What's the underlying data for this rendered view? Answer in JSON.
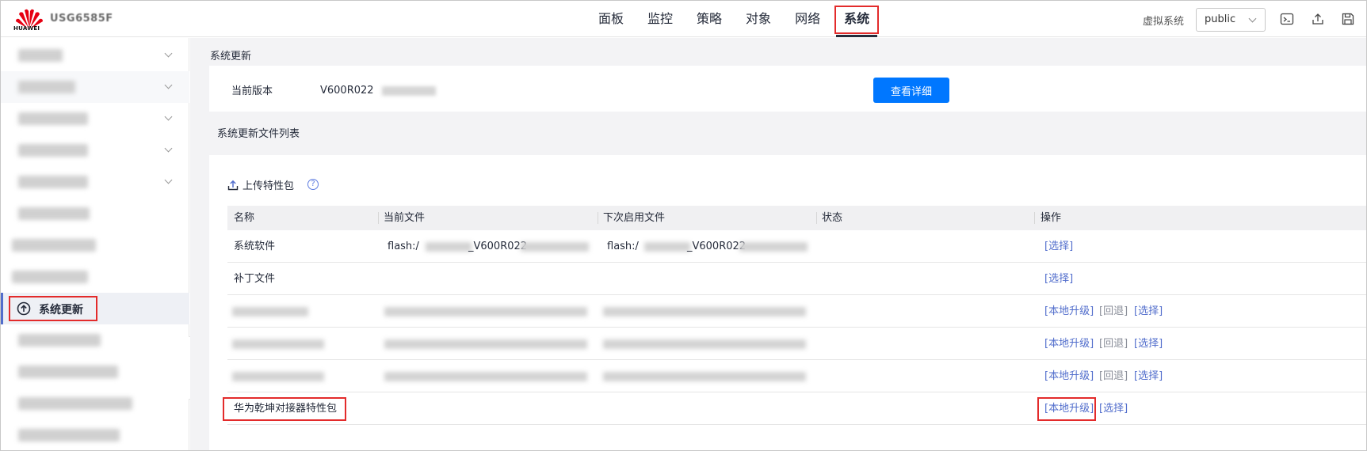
{
  "header": {
    "brand": "HUAWEI",
    "device_name": "USG6585F",
    "nav": [
      "面板",
      "监控",
      "策略",
      "对象",
      "网络",
      "系统"
    ],
    "active_nav_index": 5,
    "vsys_label": "虚拟系统",
    "vsys_value": "public",
    "icons": [
      "terminal-icon",
      "upload-icon",
      "save-icon"
    ]
  },
  "sidebar": {
    "active_label": "系统更新",
    "active_icon": "arrow-up-circle-icon"
  },
  "main": {
    "section1_title": "系统更新",
    "current_version_label": "当前版本",
    "current_version_value": "V600R022",
    "view_detail_button": "查看详细",
    "section2_title": "系统更新文件列表",
    "upload_label": "上传特性包",
    "help_icon": "?",
    "table": {
      "columns": [
        "名称",
        "当前文件",
        "下次启用文件",
        "状态",
        "操作"
      ],
      "rows": [
        {
          "name": "系统软件",
          "current_prefix": "flash:/",
          "current_mid": "_V600R022",
          "next_prefix": "flash:/",
          "next_mid": "_V600R022",
          "actions": [
            "[选择]"
          ]
        },
        {
          "name": "补丁文件",
          "actions": [
            "[选择]"
          ]
        },
        {
          "name": "",
          "actions": [
            "[本地升级]",
            "[回退]",
            "[选择]"
          ]
        },
        {
          "name": "",
          "actions": [
            "[本地升级]",
            "[回退]",
            "[选择]"
          ]
        },
        {
          "name": "",
          "actions": [
            "[本地升级]",
            "[回退]",
            "[选择]"
          ]
        },
        {
          "name": "华为乾坤对接器特性包",
          "actions": [
            "[本地升级]",
            "[选择]"
          ]
        }
      ]
    }
  }
}
